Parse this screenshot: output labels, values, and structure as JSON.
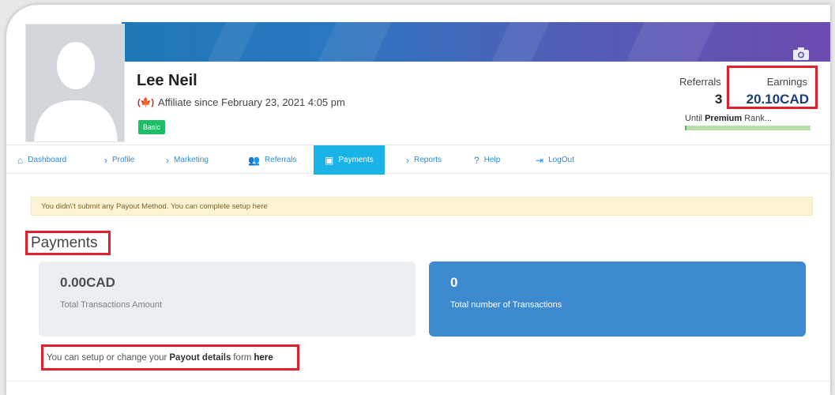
{
  "profile": {
    "name": "Lee Neil",
    "flag": "🍁",
    "since": "Affiliate since February 23, 2021 4:05 pm",
    "badge": "Basic"
  },
  "stats": {
    "referrals_label": "Referrals",
    "referrals_value": "3",
    "earnings_label": "Earnings",
    "earnings_value": "20.10CAD",
    "rank_prefix": "Until",
    "rank_name": "Premium",
    "rank_suffix": "Rank...",
    "rank_progress": 0.01
  },
  "nav": {
    "items": [
      {
        "label": "Dashboard",
        "icon": "home-icon"
      },
      {
        "label": "Profile",
        "icon": "chevron-right-icon"
      },
      {
        "label": "Marketing",
        "icon": "chevron-right-icon"
      },
      {
        "label": "Referrals",
        "icon": "users-icon"
      },
      {
        "label": "Payments",
        "icon": "money-icon",
        "active": true
      },
      {
        "label": "Reports",
        "icon": "chevron-right-icon"
      },
      {
        "label": "Help",
        "icon": "question-icon"
      },
      {
        "label": "LogOut",
        "icon": "logout-icon"
      }
    ]
  },
  "alert": {
    "text": "You didn\\'t submit any Payout Method. You can complete setup here"
  },
  "page": {
    "title": "Payments"
  },
  "tiles": {
    "amount_value": "0.00CAD",
    "amount_label": "Total Transactions Amount",
    "count_value": "0",
    "count_label": "Total number of Transactions"
  },
  "setup": {
    "prefix": "You can setup or change your",
    "bold": "Payout details",
    "middle": "form",
    "link": "here"
  },
  "colors": {
    "accent": "#1ab3e8",
    "earnings": "#1e3d73",
    "highlight": "#e0212d",
    "badge": "#1fbd66",
    "tile_blue": "#3e8ad0"
  }
}
